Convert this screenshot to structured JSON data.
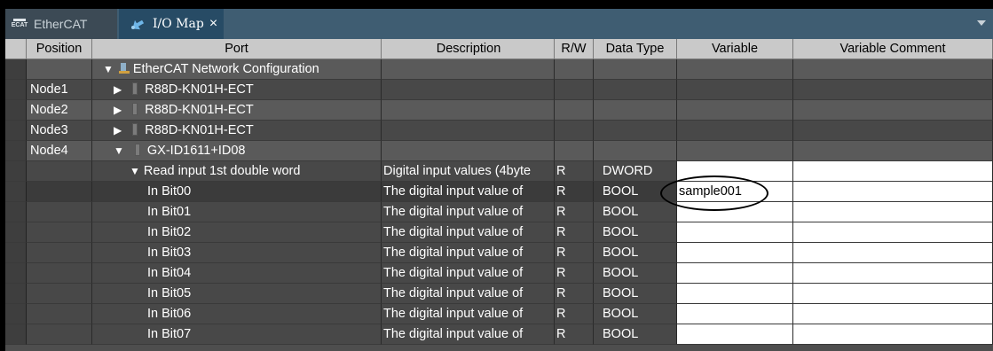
{
  "tabs": [
    {
      "label": "EtherCAT",
      "icon": "ethercat-logo-icon",
      "active": false
    },
    {
      "label": "I/O Map",
      "icon": "io-map-icon",
      "active": true,
      "closable": true
    }
  ],
  "ethercat_logo_text": [
    "ECAT"
  ],
  "columns": {
    "position": "Position",
    "port": "Port",
    "description": "Description",
    "rw": "R/W",
    "data_type": "Data Type",
    "variable": "Variable",
    "variable_comment": "Variable Comment"
  },
  "rows": [
    {
      "position": "",
      "port": "EtherCAT Network Configuration",
      "description": "",
      "rw": "",
      "data_type": "",
      "variable": "",
      "comment": ""
    },
    {
      "position": "Node1",
      "port": "R88D-KN01H-ECT",
      "description": "",
      "rw": "",
      "data_type": "",
      "variable": "",
      "comment": ""
    },
    {
      "position": "Node2",
      "port": "R88D-KN01H-ECT",
      "description": "",
      "rw": "",
      "data_type": "",
      "variable": "",
      "comment": ""
    },
    {
      "position": "Node3",
      "port": "R88D-KN01H-ECT",
      "description": "",
      "rw": "",
      "data_type": "",
      "variable": "",
      "comment": ""
    },
    {
      "position": "Node4",
      "port": "GX-ID1611+ID08",
      "description": "",
      "rw": "",
      "data_type": "",
      "variable": "",
      "comment": ""
    },
    {
      "position": "",
      "port": "Read input 1st double word",
      "description": "Digital input values (4byte",
      "rw": "R",
      "data_type": "DWORD",
      "variable": "",
      "comment": ""
    },
    {
      "position": "",
      "port": "In Bit00",
      "description": "The digital input value of",
      "rw": "R",
      "data_type": "BOOL",
      "variable": "sample001",
      "comment": ""
    },
    {
      "position": "",
      "port": "In Bit01",
      "description": "The digital input value of",
      "rw": "R",
      "data_type": "BOOL",
      "variable": "",
      "comment": ""
    },
    {
      "position": "",
      "port": "In Bit02",
      "description": "The digital input value of",
      "rw": "R",
      "data_type": "BOOL",
      "variable": "",
      "comment": ""
    },
    {
      "position": "",
      "port": "In Bit03",
      "description": "The digital input value of",
      "rw": "R",
      "data_type": "BOOL",
      "variable": "",
      "comment": ""
    },
    {
      "position": "",
      "port": "In Bit04",
      "description": "The digital input value of",
      "rw": "R",
      "data_type": "BOOL",
      "variable": "",
      "comment": ""
    },
    {
      "position": "",
      "port": "In Bit05",
      "description": "The digital input value of",
      "rw": "R",
      "data_type": "BOOL",
      "variable": "",
      "comment": ""
    },
    {
      "position": "",
      "port": "In Bit06",
      "description": "The digital input value of",
      "rw": "R",
      "data_type": "BOOL",
      "variable": "",
      "comment": ""
    },
    {
      "position": "",
      "port": "In Bit07",
      "description": "The digital input value of",
      "rw": "R",
      "data_type": "BOOL",
      "variable": "",
      "comment": ""
    }
  ],
  "colors": {
    "header_bg": "#c9c9c9",
    "grid_bg": "#4e4e4e",
    "tab_active": "#274b65",
    "tabbar": "#3f5d72"
  }
}
